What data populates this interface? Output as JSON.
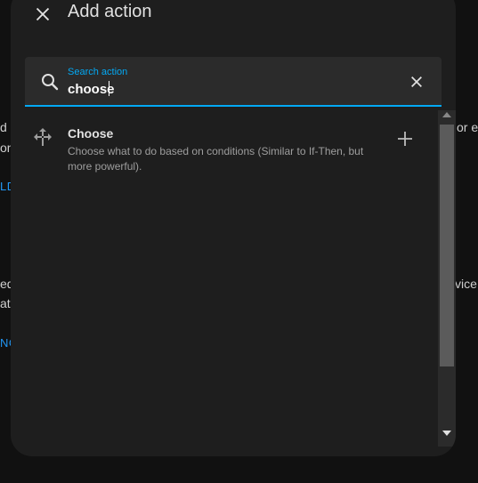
{
  "background": {
    "left_fragments": [
      "d",
      "on",
      "LD",
      "equ",
      "ate",
      "NG"
    ],
    "right_fragments": [
      "or ex",
      "vice"
    ]
  },
  "dialog": {
    "title": "Add action",
    "close_icon": "close-icon",
    "search": {
      "label": "Search action",
      "value": "choose",
      "icon": "search-icon",
      "clear_icon": "clear-icon"
    },
    "results": [
      {
        "title": "Choose",
        "description": "Choose what to do based on conditions (Similar to If-Then, but more powerful).",
        "icon": "choose-arrows-icon",
        "action_icon": "plus-icon"
      }
    ]
  },
  "colors": {
    "accent": "#03a9f4",
    "dialog_bg": "#1e1e1e",
    "page_bg": "#111111"
  }
}
